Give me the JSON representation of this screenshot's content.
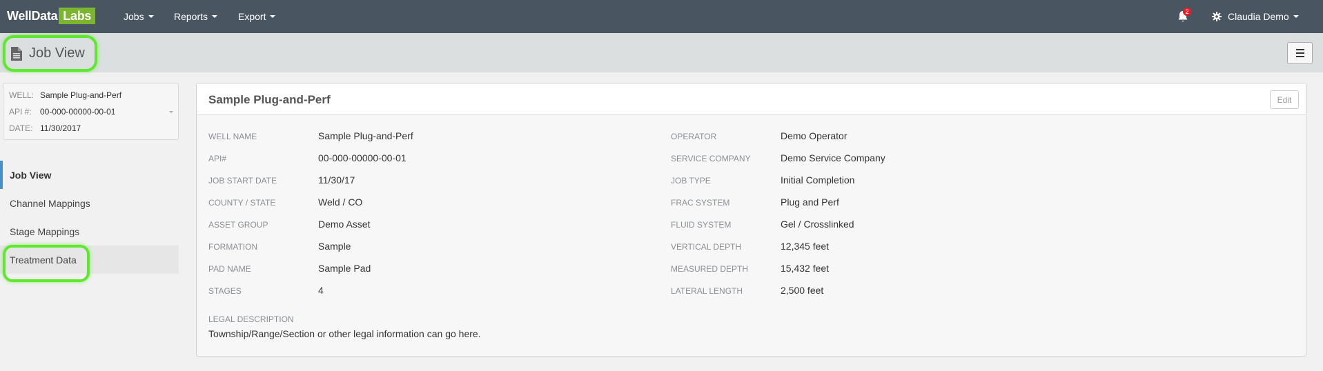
{
  "brand": {
    "part1": "WellData",
    "part2": "Labs"
  },
  "nav": {
    "jobs": "Jobs",
    "reports": "Reports",
    "export": "Export"
  },
  "notifications": {
    "count": "2"
  },
  "user": {
    "name": "Claudia Demo"
  },
  "page": {
    "title": "Job View"
  },
  "well": {
    "well_label": "WELL:",
    "well_value": "Sample Plug-and-Perf",
    "api_label": "API #:",
    "api_value": "00-000-00000-00-01",
    "date_label": "DATE:",
    "date_value": "11/30/2017"
  },
  "sidebar": {
    "items": [
      {
        "label": "Job View"
      },
      {
        "label": "Channel Mappings"
      },
      {
        "label": "Stage Mappings"
      },
      {
        "label": "Treatment Data"
      }
    ]
  },
  "panel": {
    "title": "Sample Plug-and-Perf",
    "edit_label": "Edit",
    "left_fields": [
      {
        "label": "WELL NAME",
        "value": "Sample Plug-and-Perf"
      },
      {
        "label": "API#",
        "value": "00-000-00000-00-01"
      },
      {
        "label": "JOB START DATE",
        "value": "11/30/17"
      },
      {
        "label": "COUNTY / STATE",
        "value": "Weld / CO"
      },
      {
        "label": "ASSET GROUP",
        "value": "Demo Asset"
      },
      {
        "label": "FORMATION",
        "value": "Sample"
      },
      {
        "label": "PAD NAME",
        "value": "Sample Pad"
      },
      {
        "label": "STAGES",
        "value": "4"
      }
    ],
    "right_fields": [
      {
        "label": "OPERATOR",
        "value": "Demo Operator"
      },
      {
        "label": "SERVICE COMPANY",
        "value": "Demo Service Company"
      },
      {
        "label": "JOB TYPE",
        "value": "Initial Completion"
      },
      {
        "label": "FRAC SYSTEM",
        "value": "Plug and Perf"
      },
      {
        "label": "FLUID SYSTEM",
        "value": "Gel / Crosslinked"
      },
      {
        "label": "VERTICAL DEPTH",
        "value": "12,345 feet"
      },
      {
        "label": "MEASURED DEPTH",
        "value": "15,432 feet"
      },
      {
        "label": "LATERAL LENGTH",
        "value": "2,500 feet"
      }
    ],
    "legal_label": "LEGAL DESCRIPTION",
    "legal_value": "Township/Range/Section or other legal information can go here."
  },
  "colors": {
    "navbar": "#4a5562",
    "brand_accent": "#7bb62e",
    "highlight": "#5ee82f",
    "active_nav": "#4a90c8",
    "badge": "#e0202a"
  }
}
